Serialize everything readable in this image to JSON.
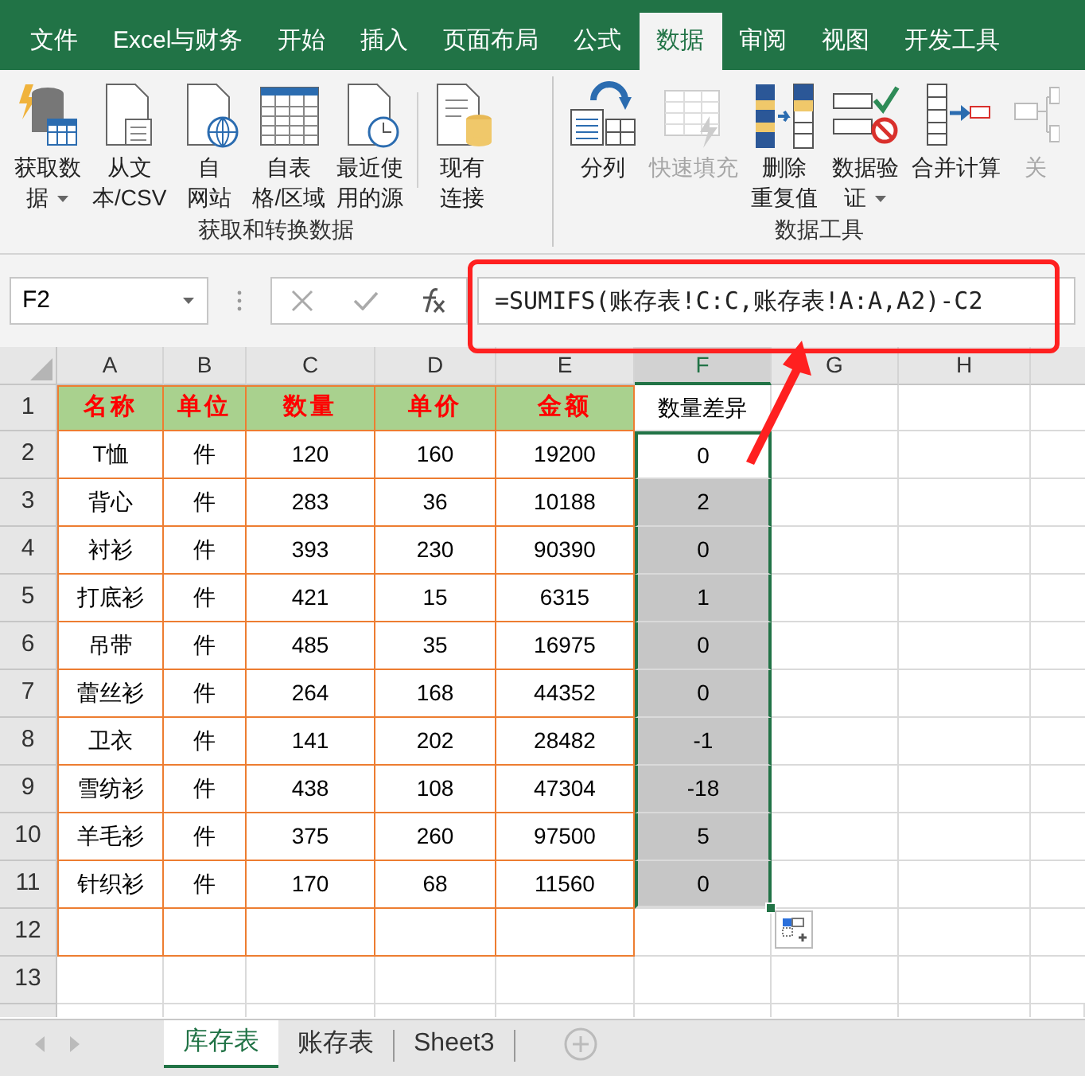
{
  "ribbon_tabs": [
    {
      "label": "文件",
      "selected": false
    },
    {
      "label": "Excel与财务",
      "selected": false
    },
    {
      "label": "开始",
      "selected": false
    },
    {
      "label": "插入",
      "selected": false
    },
    {
      "label": "页面布局",
      "selected": false
    },
    {
      "label": "公式",
      "selected": false
    },
    {
      "label": "数据",
      "selected": true
    },
    {
      "label": "审阅",
      "selected": false
    },
    {
      "label": "视图",
      "selected": false
    },
    {
      "label": "开发工具",
      "selected": false
    }
  ],
  "ribbon_groups": [
    {
      "label": "获取和转换数据",
      "buttons": [
        {
          "lines": [
            "获取数",
            "据"
          ],
          "caret": true,
          "disabled": false
        },
        {
          "lines": [
            "从文",
            "本/CSV"
          ],
          "caret": false,
          "disabled": false
        },
        {
          "lines": [
            "自",
            "网站"
          ],
          "caret": false,
          "disabled": false
        },
        {
          "lines": [
            "自表",
            "格/区域"
          ],
          "caret": false,
          "disabled": false
        },
        {
          "lines": [
            "最近使",
            "用的源"
          ],
          "caret": false,
          "disabled": false
        },
        {
          "lines": [
            "现有",
            "连接"
          ],
          "caret": false,
          "disabled": false
        }
      ]
    },
    {
      "label": "数据工具",
      "buttons": [
        {
          "lines": [
            "分列"
          ],
          "caret": false,
          "disabled": false
        },
        {
          "lines": [
            "快速填充"
          ],
          "caret": false,
          "disabled": true
        },
        {
          "lines": [
            "删除",
            "重复值"
          ],
          "caret": false,
          "disabled": false
        },
        {
          "lines": [
            "数据验",
            "证"
          ],
          "caret": true,
          "disabled": false
        },
        {
          "lines": [
            "合并计算"
          ],
          "caret": false,
          "disabled": false
        },
        {
          "lines": [
            "关"
          ],
          "caret": false,
          "disabled": true
        }
      ]
    }
  ],
  "name_box": "F2",
  "formula": "=SUMIFS(账存表!C:C,账存表!A:A,A2)-C2",
  "column_headers": [
    {
      "label": "A",
      "selected": false
    },
    {
      "label": "B",
      "selected": false
    },
    {
      "label": "C",
      "selected": false
    },
    {
      "label": "D",
      "selected": false
    },
    {
      "label": "E",
      "selected": false
    },
    {
      "label": "F",
      "selected": true
    },
    {
      "label": "G",
      "selected": false
    },
    {
      "label": "H",
      "selected": false
    }
  ],
  "row_headers": [
    "1",
    "2",
    "3",
    "4",
    "5",
    "6",
    "7",
    "8",
    "9",
    "10",
    "11",
    "12",
    "13"
  ],
  "table_header": [
    "名称",
    "单位",
    "数量",
    "单价",
    "金额"
  ],
  "diff_header": "数量差异",
  "rows": [
    {
      "cells": [
        "T恤",
        "件",
        "120",
        "160",
        "19200"
      ],
      "diff": "0",
      "selected": true,
      "active": true
    },
    {
      "cells": [
        "背心",
        "件",
        "283",
        "36",
        "10188"
      ],
      "diff": "2",
      "selected": true,
      "active": false
    },
    {
      "cells": [
        "衬衫",
        "件",
        "393",
        "230",
        "90390"
      ],
      "diff": "0",
      "selected": true,
      "active": false
    },
    {
      "cells": [
        "打底衫",
        "件",
        "421",
        "15",
        "6315"
      ],
      "diff": "1",
      "selected": true,
      "active": false
    },
    {
      "cells": [
        "吊带",
        "件",
        "485",
        "35",
        "16975"
      ],
      "diff": "0",
      "selected": true,
      "active": false
    },
    {
      "cells": [
        "蕾丝衫",
        "件",
        "264",
        "168",
        "44352"
      ],
      "diff": "0",
      "selected": true,
      "active": false
    },
    {
      "cells": [
        "卫衣",
        "件",
        "141",
        "202",
        "28482"
      ],
      "diff": "-1",
      "selected": true,
      "active": false
    },
    {
      "cells": [
        "雪纺衫",
        "件",
        "438",
        "108",
        "47304"
      ],
      "diff": "-18",
      "selected": true,
      "active": false
    },
    {
      "cells": [
        "羊毛衫",
        "件",
        "375",
        "260",
        "97500"
      ],
      "diff": "5",
      "selected": true,
      "active": false
    },
    {
      "cells": [
        "针织衫",
        "件",
        "170",
        "68",
        "11560"
      ],
      "diff": "0",
      "selected": true,
      "active": false
    }
  ],
  "sheet_tabs": [
    {
      "label": "库存表",
      "selected": true
    },
    {
      "label": "账存表",
      "selected": false
    },
    {
      "label": "Sheet3",
      "selected": false
    }
  ]
}
